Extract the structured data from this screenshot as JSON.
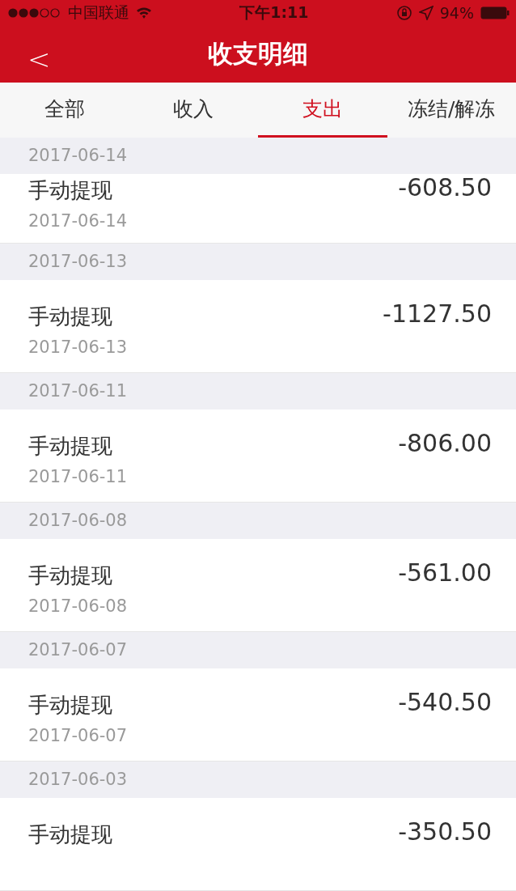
{
  "status_bar": {
    "carrier": "中国联通",
    "time": "下午1:11",
    "battery": "94%"
  },
  "nav": {
    "back": "<",
    "title": "收支明细"
  },
  "tabs": [
    {
      "label": "全部",
      "selected": false
    },
    {
      "label": "收入",
      "selected": false
    },
    {
      "label": "支出",
      "selected": true
    },
    {
      "label": "冻结/解冻",
      "selected": false
    }
  ],
  "groups": [
    {
      "date": "2017-06-14",
      "items": [
        {
          "title": "手动提现",
          "date": "2017-06-14",
          "amount": "-608.50"
        }
      ]
    },
    {
      "date": "2017-06-13",
      "items": [
        {
          "title": "手动提现",
          "date": "2017-06-13",
          "amount": "-1127.50"
        }
      ]
    },
    {
      "date": "2017-06-11",
      "items": [
        {
          "title": "手动提现",
          "date": "2017-06-11",
          "amount": "-806.00"
        }
      ]
    },
    {
      "date": "2017-06-08",
      "items": [
        {
          "title": "手动提现",
          "date": "2017-06-08",
          "amount": "-561.00"
        }
      ]
    },
    {
      "date": "2017-06-07",
      "items": [
        {
          "title": "手动提现",
          "date": "2017-06-07",
          "amount": "-540.50"
        }
      ]
    },
    {
      "date": "2017-06-03",
      "items": [
        {
          "title": "手动提现",
          "amount": "-350.50"
        }
      ]
    }
  ]
}
